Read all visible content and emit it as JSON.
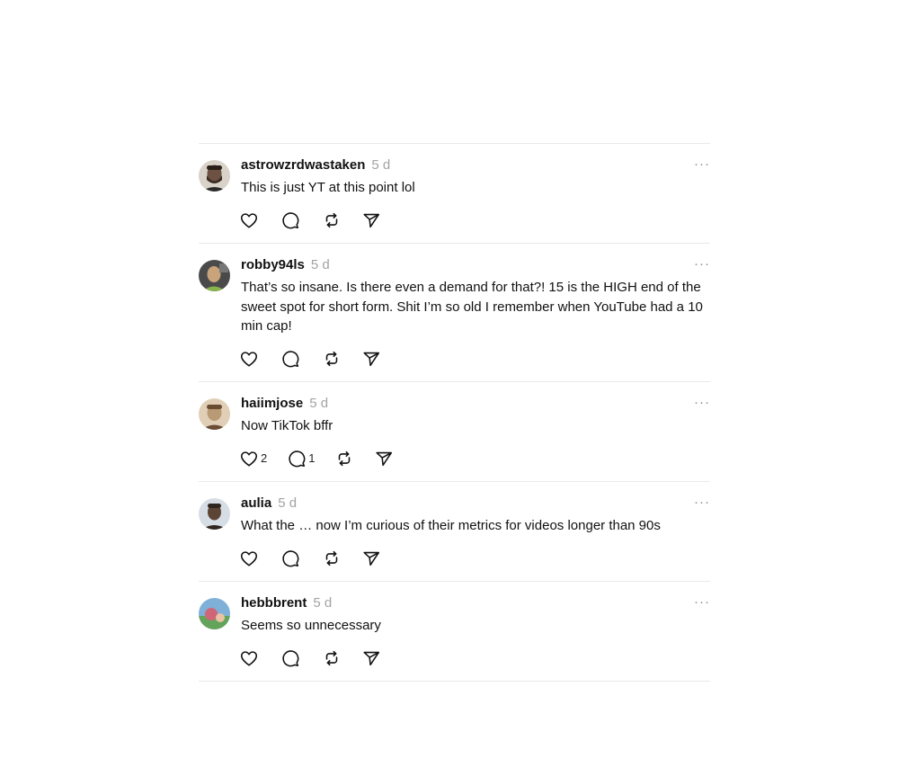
{
  "comments": [
    {
      "username": "astrowzrdwastaken",
      "time": "5 d",
      "text": "This is just YT at this point lol",
      "likes": "",
      "replies": "",
      "avatar_colors": [
        "#d9d2c8",
        "#3a2b22",
        "#6d5142"
      ]
    },
    {
      "username": "robby94ls",
      "time": "5 d",
      "text": "That’s so insane. Is there even a demand for that?! 15 is the HIGH end of the sweet spot for short form. Shit I’m so old I remember when YouTube had a 10 min cap!",
      "likes": "",
      "replies": "",
      "avatar_colors": [
        "#4a4a4a",
        "#c9a37a",
        "#89b34c"
      ]
    },
    {
      "username": "haiimjose",
      "time": "5 d",
      "text": "Now TikTok bffr",
      "likes": "2",
      "replies": "1",
      "avatar_colors": [
        "#b89a74",
        "#6a4b34",
        "#e0cfb6"
      ]
    },
    {
      "username": "aulia",
      "time": "5 d",
      "text": "What the … now I’m curious of their metrics for videos longer than 90s",
      "likes": "",
      "replies": "",
      "avatar_colors": [
        "#d6dde4",
        "#2f2620",
        "#5d4536"
      ]
    },
    {
      "username": "hebbbrent",
      "time": "5 d",
      "text": "Seems so unnecessary",
      "likes": "",
      "replies": "",
      "avatar_colors": [
        "#7fb0d8",
        "#d0657a",
        "#63a35a"
      ]
    }
  ],
  "more_label": "···",
  "icons": {
    "like": "heart-icon",
    "reply": "comment-icon",
    "repost": "repost-icon",
    "share": "send-icon"
  }
}
